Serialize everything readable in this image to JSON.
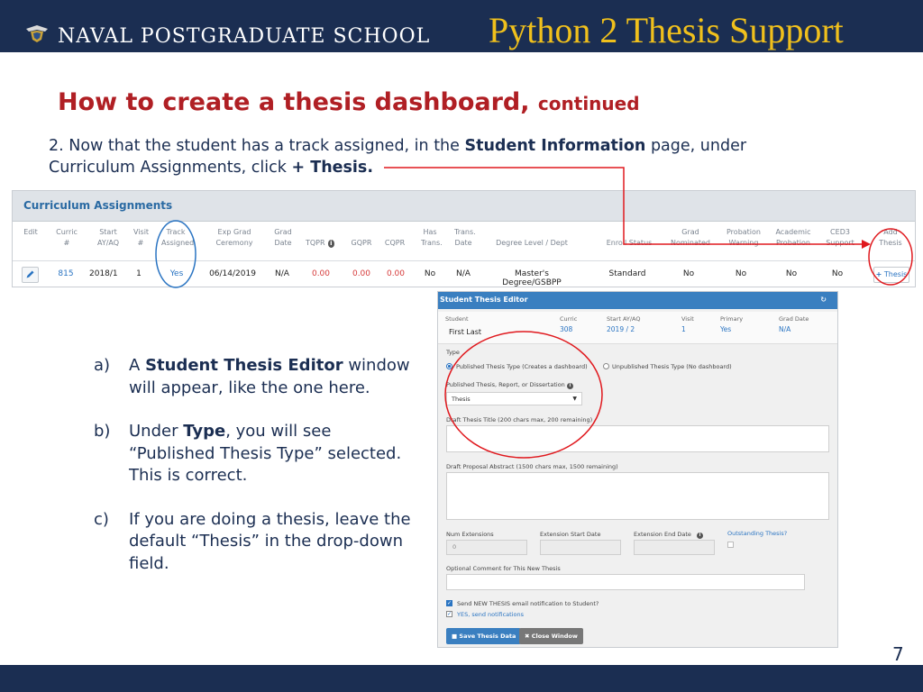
{
  "header": {
    "school_name": "NAVAL POSTGRADUATE SCHOOL",
    "deck_title": "Python 2 Thesis Support"
  },
  "slide": {
    "heading": "How to create a thesis dashboard,",
    "heading_sub": "continued",
    "step_intro": "2.  Now that the student has a track assigned, in the",
    "step_bold_1": "Student Information",
    "step_mid": "page, under Curriculum Assignments, click",
    "step_bold_2": "+ Thesis.",
    "page_number": "7"
  },
  "curriculum": {
    "title": "Curriculum Assignments",
    "columns": [
      [
        "Edit",
        ""
      ],
      [
        "Curric",
        "#"
      ],
      [
        "Start",
        "AY/AQ"
      ],
      [
        "Visit",
        "#"
      ],
      [
        "Track",
        "Assigned"
      ],
      [
        "Exp Grad",
        "Ceremony"
      ],
      [
        "Grad",
        "Date"
      ],
      [
        "",
        "TQPR"
      ],
      [
        "",
        "GQPR"
      ],
      [
        "",
        "CQPR"
      ],
      [
        "Has",
        "Trans."
      ],
      [
        "Trans.",
        "Date"
      ],
      [
        "",
        "Degree Level / Dept"
      ],
      [
        "",
        "Enroll Status"
      ],
      [
        "Grad",
        "Nominated"
      ],
      [
        "Probation",
        "Warning"
      ],
      [
        "Academic",
        "Probation"
      ],
      [
        "CED3",
        "Support"
      ],
      [
        "Add",
        "Thesis"
      ]
    ],
    "row": {
      "curric": "815",
      "start": "2018/1",
      "visit": "1",
      "track": "Yes",
      "exp_grad": "06/14/2019",
      "grad_date": "N/A",
      "tqpr": "0.00",
      "gqpr": "0.00",
      "cqpr": "0.00",
      "has_trans": "No",
      "trans_date": "N/A",
      "degree": "Master's Degree/GSBPP",
      "enroll_status": "Standard",
      "grad_nominated": "No",
      "probation_warning": "No",
      "academic_probation": "No",
      "ced3": "No",
      "add_thesis_label": "Thesis"
    }
  },
  "instructions": [
    {
      "mark": "a)",
      "pre": "A",
      "bold": "Student Thesis Editor",
      "post": "window will appear, like the one here."
    },
    {
      "mark": "b)",
      "pre": "Under",
      "bold": "Type",
      "post": ", you will see “Published Thesis Type” selected. This is correct."
    },
    {
      "mark": "c)",
      "pre": "If you are doing a thesis, leave the default “Thesis” in the drop-down field.",
      "bold": "",
      "post": ""
    }
  ],
  "editor": {
    "title": "Student Thesis Editor",
    "summary": {
      "student_label": "Student",
      "student_value": "First Last",
      "curric_label": "Curric",
      "curric_value": "308",
      "start_label": "Start AY/AQ",
      "start_value": "2019 / 2",
      "visit_label": "Visit",
      "visit_value": "1",
      "primary_label": "Primary",
      "primary_value": "Yes",
      "grad_label": "Grad Date",
      "grad_value": "N/A"
    },
    "type_label": "Type",
    "radio_published": "Published Thesis Type (Creates a dashboard)",
    "radio_unpublished": "Unpublished Thesis Type (No dashboard)",
    "pub_label": "Published Thesis, Report, or Dissertation",
    "pub_select_value": "Thesis",
    "draft_title_label": "Draft Thesis Title (200 chars max, 200 remaining)",
    "draft_abstract_label": "Draft Proposal Abstract (1500 chars max, 1500 remaining)",
    "num_ext_label": "Num Extensions",
    "num_ext_value": "0",
    "ext_start_label": "Extension Start Date",
    "ext_end_label": "Extension End Date",
    "outstanding_label": "Outstanding Thesis?",
    "comment_label": "Optional Comment for This New Thesis",
    "notify_label": "Send NEW THESIS email notification to Student?",
    "notify_yes": "YES, send notifications",
    "save_button": "Save Thesis Data",
    "close_button": "Close Window"
  },
  "colors": {
    "navy": "#1b2e52",
    "gold": "#f0c01c",
    "heading_red": "#b01f24",
    "highlight_red": "#e0191e",
    "callout_blue": "#2a74c2"
  }
}
